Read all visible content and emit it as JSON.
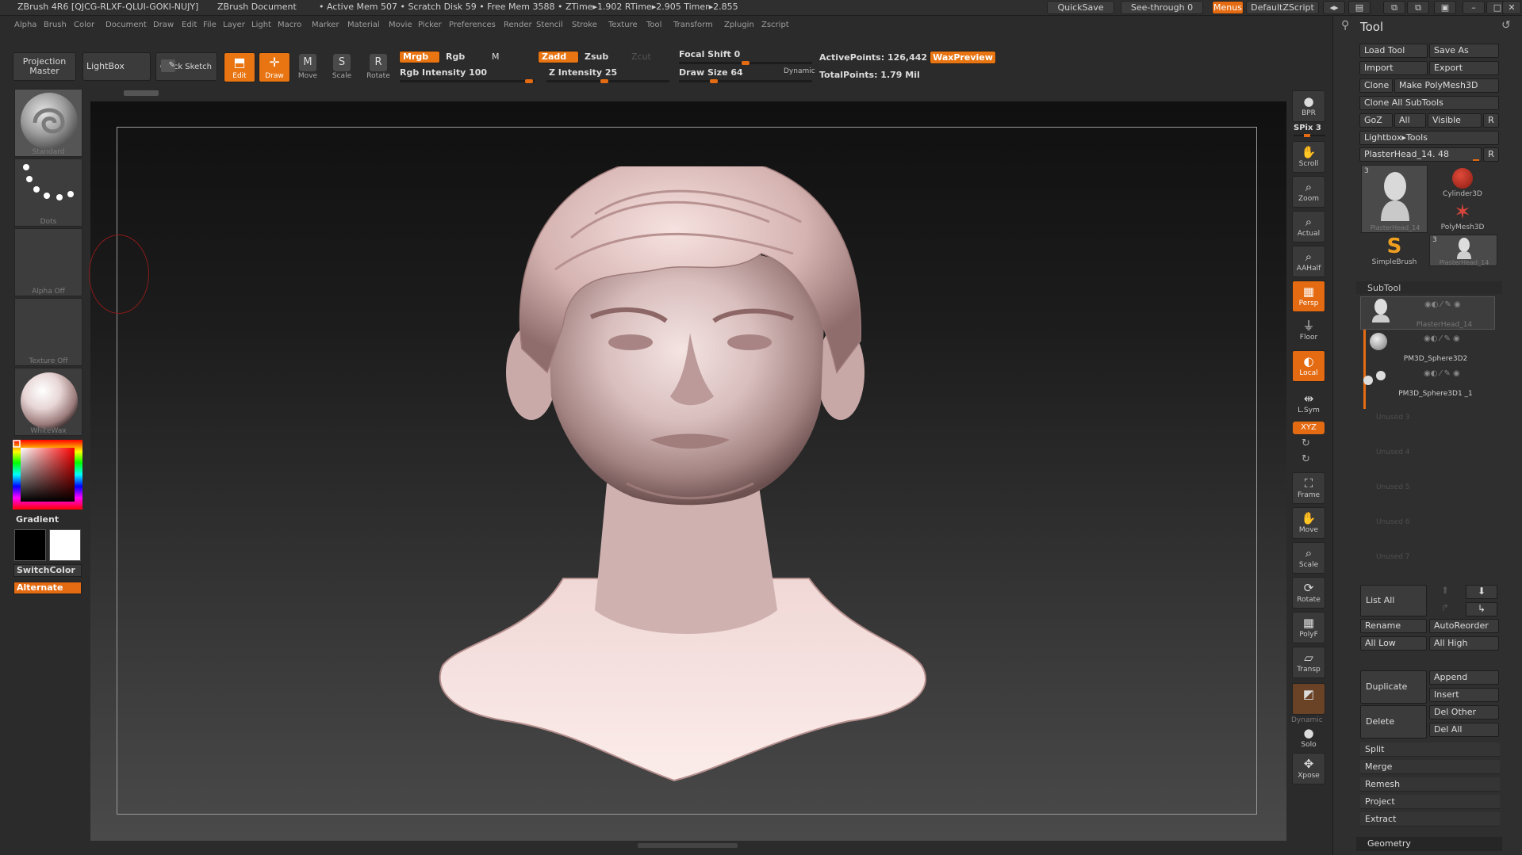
{
  "titlebar": {
    "app": "ZBrush 4R6 [QJCG-RLXF-QLUI-GOKI-NUJY]",
    "document": "ZBrush Document",
    "stats": "• Active Mem 507 • Scratch Disk 59 • Free Mem 3588 • ZTime▸1.902 RTime▸2.905 Timer▸2.855",
    "quicksave": "QuickSave",
    "see_through": "See-through  0",
    "menus": "Menus",
    "zscript": "DefaultZScript"
  },
  "menubar": [
    "Alpha",
    "Brush",
    "Color",
    "Document",
    "Draw",
    "Edit",
    "File",
    "Layer",
    "Light",
    "Macro",
    "Marker",
    "Material",
    "Movie",
    "Picker",
    "Preferences",
    "Render",
    "Stencil",
    "Stroke",
    "Texture",
    "Tool",
    "Transform",
    "Zplugin",
    "Zscript"
  ],
  "shelf": {
    "projection_master": "Projection Master",
    "lightbox": "LightBox",
    "quick_sketch": "Quick Sketch",
    "edit": "Edit",
    "draw": "Draw",
    "move": "Move",
    "scale": "Scale",
    "rotate": "Rotate",
    "mrgb": "Mrgb",
    "rgb": "Rgb",
    "m": "M",
    "rgb_intensity": "Rgb Intensity 100",
    "rgb_intensity_value": 100,
    "zadd": "Zadd",
    "zsub": "Zsub",
    "zcut": "Zcut",
    "z_intensity": "Z Intensity 25",
    "z_intensity_value": 25,
    "focal_shift": "Focal Shift 0",
    "draw_size": "Draw Size 64",
    "dynamic": "Dynamic",
    "active_points": "ActivePoints: 126,442",
    "total_points": "TotalPoints: 1.79 Mil",
    "wax_preview": "WaxPreview"
  },
  "lefttray": {
    "brush_label": "Standard",
    "stroke_label": "Dots",
    "alpha_label": "Alpha  Off",
    "texture_label": "Texture  Off",
    "material_label": "WhiteWax",
    "gradient": "Gradient",
    "switch_color": "SwitchColor",
    "alternate": "Alternate",
    "colors": {
      "main": "#000000",
      "secondary": "#ffffff",
      "accent": "#e46b12"
    }
  },
  "rightdock": {
    "bpr": "BPR",
    "spix": "SPix 3",
    "scroll": "Scroll",
    "zoom": "Zoom",
    "actual": "Actual",
    "aahalf": "AAHalf",
    "persp": "Persp",
    "floor": "Floor",
    "local": "Local",
    "lsym": "L.Sym",
    "xyz": "XYZ",
    "frame": "Frame",
    "move": "Move",
    "scale": "Scale",
    "rotate": "Rotate",
    "polyf": "PolyF",
    "transp": "Transp",
    "dynamic": "Dynamic",
    "solo": "Solo",
    "xpose": "Xpose"
  },
  "tool": {
    "title": "Tool",
    "load_tool": "Load Tool",
    "save_as": "Save As",
    "import": "Import",
    "export": "Export",
    "clone": "Clone",
    "make_polymesh": "Make PolyMesh3D",
    "clone_all": "Clone All SubTools",
    "goz": "GoZ",
    "all": "All",
    "visible": "Visible",
    "r": "R",
    "lightbox_tools": "Lightbox▸Tools",
    "current_tool": "PlasterHead_14. 48",
    "tiles": [
      "PlasterHead_14",
      "Cylinder3D",
      "PolyMesh3D",
      "SimpleBrush",
      "PlasterHead_14"
    ],
    "tile_count_a": "3",
    "tile_count_b": "3",
    "subtool_header": "SubTool",
    "subtools": [
      "PlasterHead_14",
      "PM3D_Sphere3D2",
      "PM3D_Sphere3D1 _1"
    ],
    "unused": [
      "Unused 3",
      "Unused 4",
      "Unused 5",
      "Unused 6",
      "Unused 7"
    ],
    "list_all": "List All",
    "rename": "Rename",
    "autoreorder": "AutoReorder",
    "all_low": "All Low",
    "all_high": "All High",
    "duplicate": "Duplicate",
    "append": "Append",
    "insert": "Insert",
    "delete": "Delete",
    "del_other": "Del Other",
    "del_all": "Del All",
    "split": "Split",
    "merge": "Merge",
    "remesh": "Remesh",
    "project": "Project",
    "extract": "Extract",
    "geometry": "Geometry"
  }
}
